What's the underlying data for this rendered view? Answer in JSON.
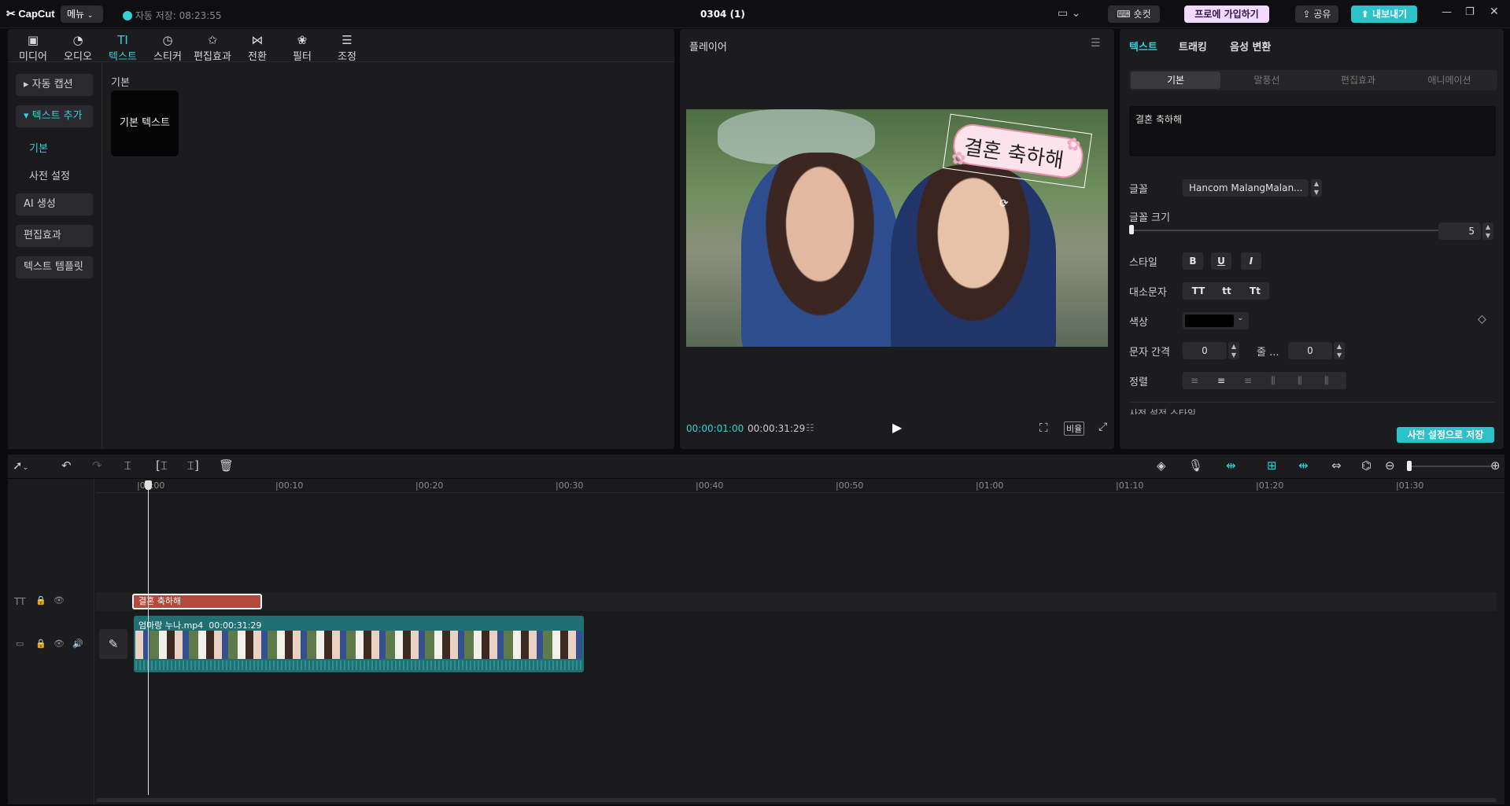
{
  "app": {
    "logo": "CapCut",
    "menu_label": "메뉴",
    "autosave": "자동 저장: 08:23:55",
    "project_title": "0304 (1)",
    "shortcut_label": "숏컷",
    "pro_label": "프로에 가입하기",
    "share_label": "공유",
    "export_label": "내보내기"
  },
  "toolbar": [
    {
      "label": "미디어",
      "icon": "media-icon"
    },
    {
      "label": "오디오",
      "icon": "audio-icon"
    },
    {
      "label": "텍스트",
      "icon": "text-icon",
      "active": true
    },
    {
      "label": "스티커",
      "icon": "sticker-icon"
    },
    {
      "label": "편집효과",
      "icon": "effects-icon"
    },
    {
      "label": "전환",
      "icon": "transition-icon"
    },
    {
      "label": "필터",
      "icon": "filter-icon"
    },
    {
      "label": "조정",
      "icon": "adjust-icon"
    }
  ],
  "sidebar": {
    "auto_caption": "자동 캡션",
    "add_text": "텍스트 추가",
    "basic": "기본",
    "preset": "사전 설정",
    "ai_generate": "AI 생성",
    "effects": "편집효과",
    "templates": "텍스트 템플릿"
  },
  "library": {
    "section_title": "기본",
    "card_label": "기본 텍스트"
  },
  "player": {
    "title": "플레이어",
    "overlay_text": "결혼 축하해",
    "current_time": "00:00:01:00",
    "total_time": "00:00:31:29",
    "ratio_label": "비율"
  },
  "inspector": {
    "tabs": [
      "텍스트",
      "트래킹",
      "음성 변환"
    ],
    "subtabs": [
      "기본",
      "말풍선",
      "편집효과",
      "애니메이션"
    ],
    "text_value": "결혼 축하해",
    "font_label": "글꼴",
    "font_value": "Hancom MalangMalan...",
    "size_label": "글꼴 크기",
    "size_value": "5",
    "style_label": "스타일",
    "style_buttons": [
      "B",
      "U",
      "I"
    ],
    "case_label": "대소문자",
    "case_buttons": [
      "TT",
      "tt",
      "Tt"
    ],
    "color_label": "색상",
    "spacing_label": "문자 간격",
    "spacing_value": "0",
    "line_label": "줄 ...",
    "line_value": "0",
    "align_label": "정렬",
    "preset_partial": "사전 설정 스타일",
    "save_preset": "사전 설정으로 저장"
  },
  "timeline": {
    "ticks": [
      "|00:00",
      "|00:10",
      "|00:20",
      "|00:30",
      "|00:40",
      "|00:50",
      "|01:00",
      "|01:10",
      "|01:20",
      "|01:30"
    ],
    "text_clip": "결혼 축하해",
    "video_clip_name": "엄마랑 누나.mp4",
    "video_clip_duration": "00:00:31:29"
  },
  "colors": {
    "accent": "#35d0d8",
    "panel": "#1c1c1f",
    "text_clip": "#b2493c",
    "video_clip": "#1f6f73",
    "export": "#2bc2c9",
    "pro_bg": "#f2d9ff"
  }
}
